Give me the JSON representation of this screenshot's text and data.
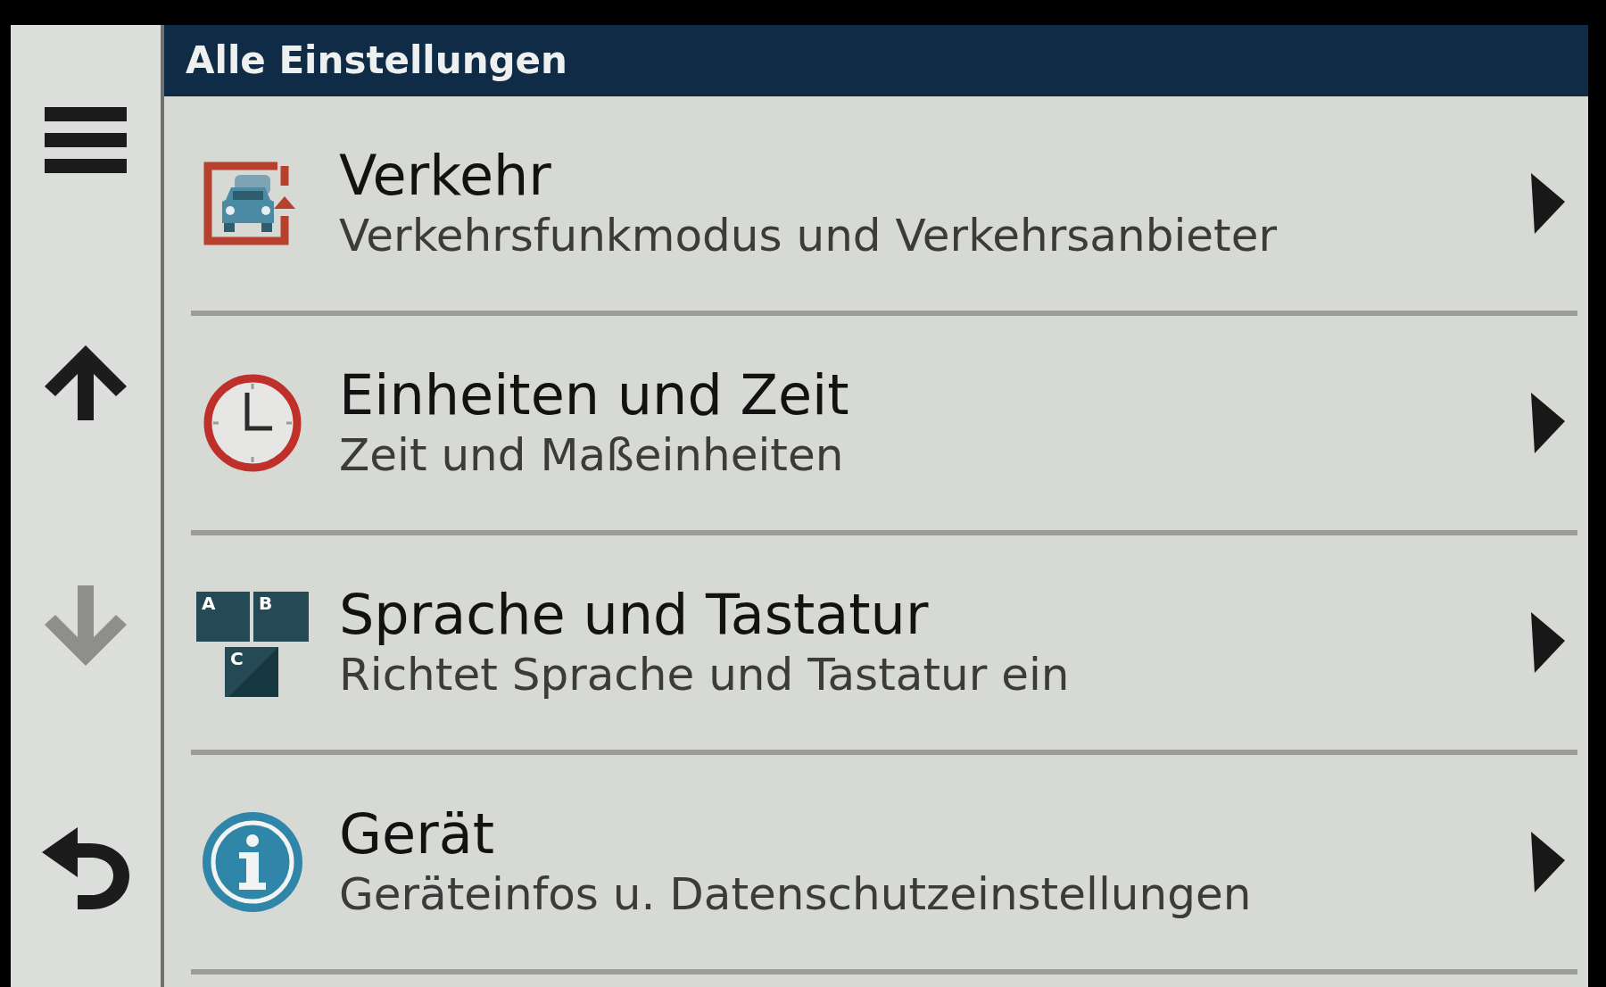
{
  "header": {
    "title": "Alle Einstellungen"
  },
  "side_buttons": [
    {
      "kind": "menu",
      "disabled": false
    },
    {
      "kind": "up",
      "disabled": false
    },
    {
      "kind": "down",
      "disabled": true
    },
    {
      "kind": "back",
      "disabled": false
    }
  ],
  "items": [
    {
      "kind": "traffic",
      "title": "Verkehr",
      "subtitle": "Verkehrsfunkmodus und Verkehrsanbieter"
    },
    {
      "kind": "clock",
      "title": "Einheiten und Zeit",
      "subtitle": "Zeit und Maßeinheiten"
    },
    {
      "kind": "keys",
      "title": "Sprache und Tastatur",
      "subtitle": "Richtet Sprache und Tastatur ein",
      "icon_letters": [
        "A",
        "B",
        "C"
      ]
    },
    {
      "kind": "info",
      "title": "Gerät",
      "subtitle": "Geräteinfos u. Datenschutzeinstellungen"
    }
  ]
}
